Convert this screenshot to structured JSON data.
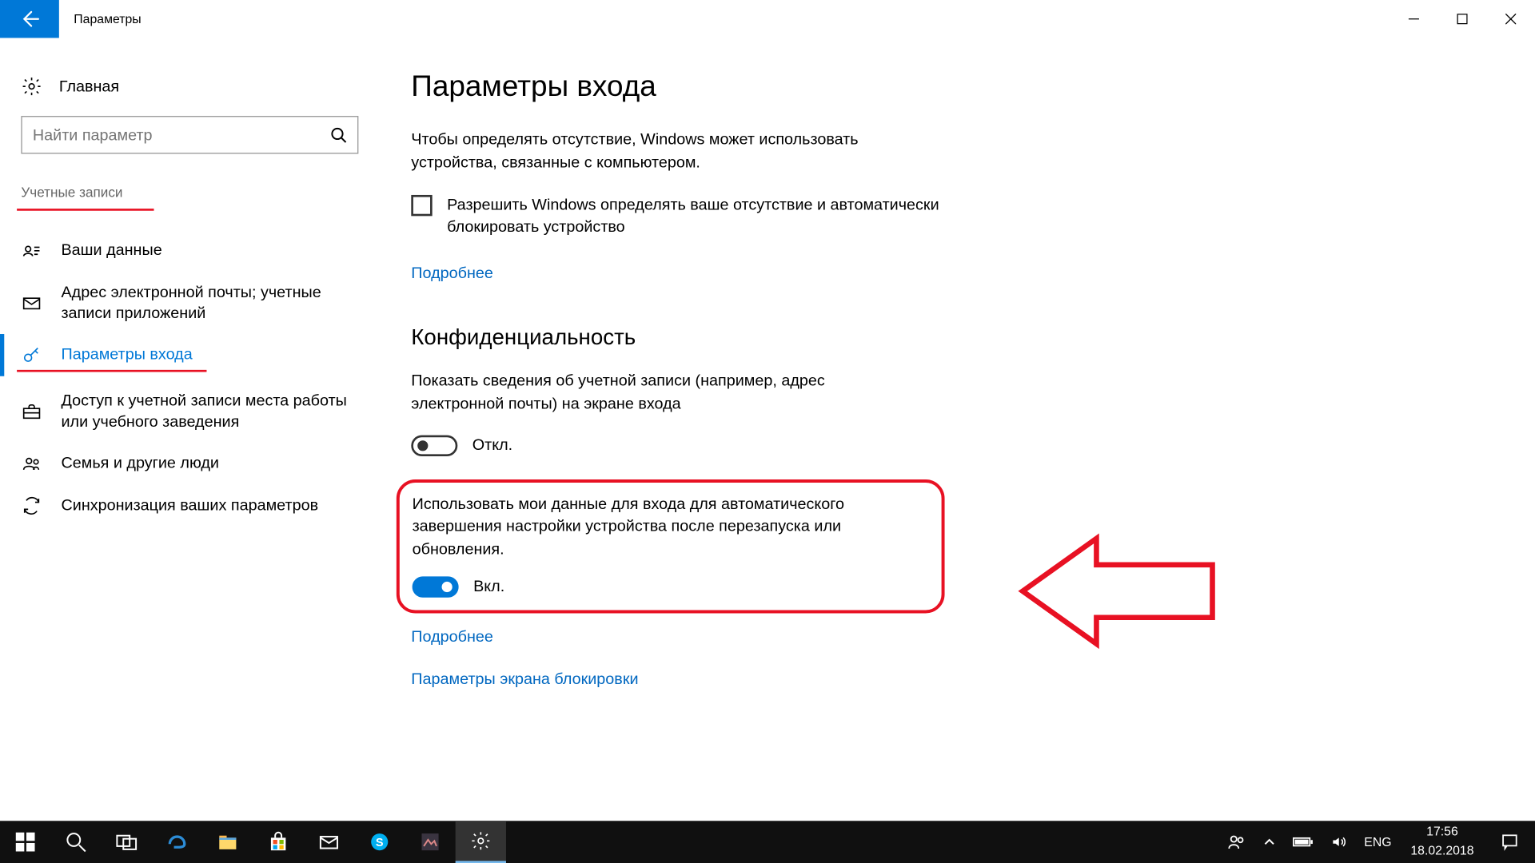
{
  "titlebar": {
    "title": "Параметры"
  },
  "sidebar": {
    "home": "Главная",
    "search_placeholder": "Найти параметр",
    "category": "Учетные записи",
    "items": [
      {
        "label": "Ваши данные"
      },
      {
        "label": "Адрес электронной почты; учетные записи приложений"
      },
      {
        "label": "Параметры входа"
      },
      {
        "label": "Доступ к учетной записи места работы или учебного заведения"
      },
      {
        "label": "Семья и другие люди"
      },
      {
        "label": "Синхронизация ваших параметров"
      }
    ]
  },
  "main": {
    "heading": "Параметры входа",
    "presence_para": "Чтобы определять отсутствие, Windows может использовать устройства, связанные с компьютером.",
    "checkbox_label": "Разрешить Windows определять ваше отсутствие и автоматически блокировать устройство",
    "learn_more": "Подробнее",
    "privacy_heading": "Конфиденциальность",
    "privacy_para": "Показать сведения об учетной записи (например, адрес электронной почты) на экране входа",
    "toggle1_state": "Откл.",
    "highlight_para": "Использовать мои данные для входа для автоматического завершения настройки устройства после перезапуска или обновления.",
    "toggle2_state": "Вкл.",
    "learn_more2": "Подробнее",
    "lockscreen_link": "Параметры экрана блокировки"
  },
  "taskbar": {
    "lang": "ENG",
    "time": "17:56",
    "date": "18.02.2018"
  }
}
